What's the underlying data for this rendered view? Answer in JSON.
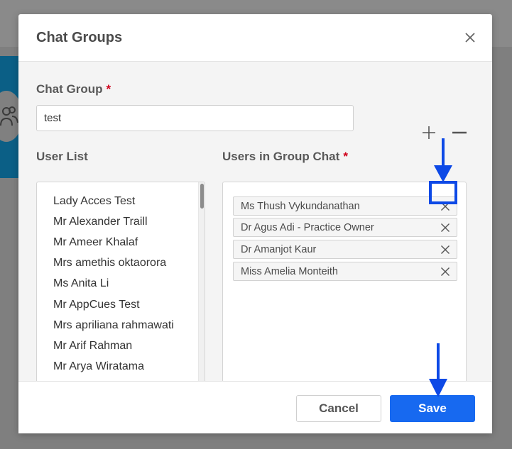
{
  "dialog": {
    "title": "Chat Groups"
  },
  "chat_group": {
    "label": "Chat Group",
    "required_mark": "*",
    "value": "test"
  },
  "user_list": {
    "label": "User List",
    "items": [
      "Lady Acces Test",
      "Mr Alexander Traill",
      "Mr Ameer Khalaf",
      "Mrs amethis oktaorora",
      "Ms Anita Li",
      "Mr AppCues Test",
      "Mrs apriliana rahmawati",
      "Mr Arif Rahman",
      "Mr Arya Wiratama"
    ]
  },
  "group_users": {
    "label": "Users in Group Chat",
    "required_mark": "*",
    "items": [
      "Ms Thush Vykundanathan",
      "Dr Agus Adi - Practice Owner",
      "Dr Amanjot Kaur",
      "Miss Amelia Monteith"
    ]
  },
  "footer": {
    "cancel_label": "Cancel",
    "save_label": "Save"
  },
  "colors": {
    "primary": "#1769f0",
    "required": "#d0021b",
    "annotation": "#0d49e6"
  }
}
